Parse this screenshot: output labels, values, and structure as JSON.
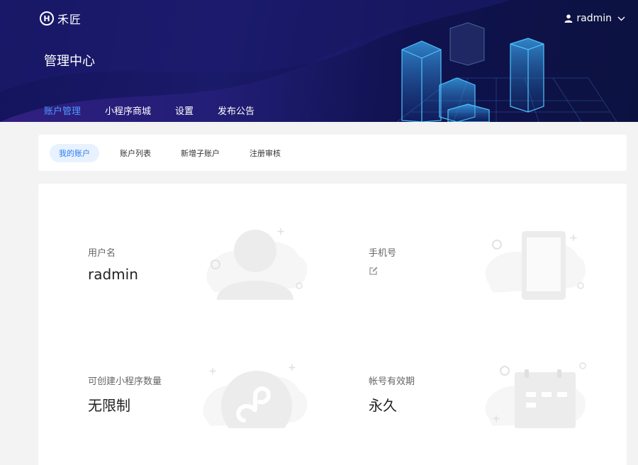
{
  "brand": {
    "name": "禾匠",
    "mark": "H",
    "logo_icon": "logo-mark-icon"
  },
  "user": {
    "name": "radmin",
    "icon": "user-icon",
    "dropdown_icon": "chevron-down-icon"
  },
  "page_title": "管理中心",
  "main_nav": [
    {
      "label": "账户管理",
      "active": true
    },
    {
      "label": "小程序商城",
      "active": false
    },
    {
      "label": "设置",
      "active": false
    },
    {
      "label": "发布公告",
      "active": false
    }
  ],
  "sub_nav": [
    {
      "label": "我的账户",
      "active": true
    },
    {
      "label": "账户列表",
      "active": false
    },
    {
      "label": "新增子账户",
      "active": false
    },
    {
      "label": "注册审核",
      "active": false
    }
  ],
  "account": {
    "username": {
      "label": "用户名",
      "value": "radmin",
      "icon": "user-illustration-icon"
    },
    "phone": {
      "label": "手机号",
      "value": "",
      "edit_icon": "edit-icon",
      "icon": "phone-illustration-icon"
    },
    "app_limit": {
      "label": "可创建小程序数量",
      "value": "无限制",
      "icon": "mini-program-illustration-icon"
    },
    "validity": {
      "label": "帐号有效期",
      "value": "永久",
      "icon": "calendar-illustration-icon"
    }
  },
  "colors": {
    "accent": "#3f8cff",
    "header_bg": "#14135c",
    "active_pill": "#e8f2ff"
  }
}
